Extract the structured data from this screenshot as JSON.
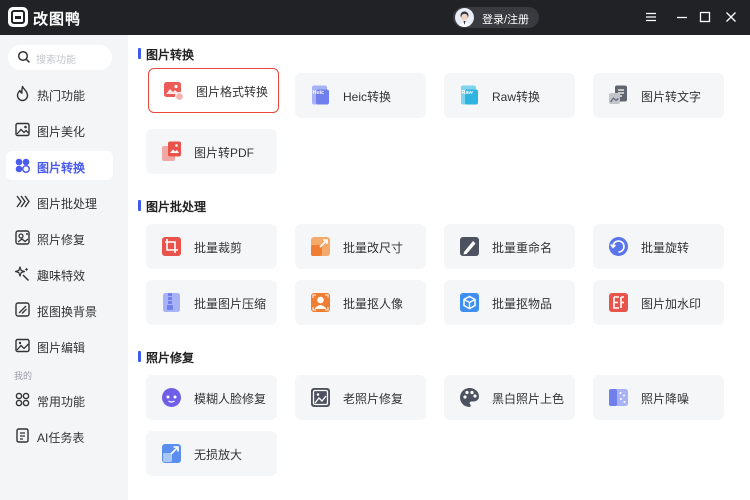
{
  "app": {
    "title": "改图鸭",
    "login_label": "登录/注册"
  },
  "colors": {
    "titlebar": "#212226",
    "accent": "#4a5cf0",
    "selected_border": "#e8483c",
    "sidebar_bg": "#f4f5f7",
    "card_bg": "#f5f6f8"
  },
  "sidebar": {
    "search_placeholder": "搜索功能",
    "items": [
      {
        "label": "热门功能",
        "icon": "fire-icon"
      },
      {
        "label": "图片美化",
        "icon": "image-beautify-icon"
      },
      {
        "label": "图片转换",
        "icon": "image-convert-icon",
        "active": true
      },
      {
        "label": "图片批处理",
        "icon": "batch-icon"
      },
      {
        "label": "照片修复",
        "icon": "photo-repair-icon"
      },
      {
        "label": "趣味特效",
        "icon": "sparkle-icon"
      },
      {
        "label": "抠图换背景",
        "icon": "cutout-icon"
      },
      {
        "label": "图片编辑",
        "icon": "image-edit-icon"
      }
    ],
    "group_label": "我的",
    "my_items": [
      {
        "label": "常用功能",
        "icon": "grid-icon"
      },
      {
        "label": "AI任务表",
        "icon": "task-list-icon"
      }
    ]
  },
  "sections": [
    {
      "title": "图片转换",
      "cards": [
        {
          "label": "图片格式转换",
          "icon": "image-format-icon",
          "selected": true
        },
        {
          "label": "Heic转换",
          "icon": "heic-icon"
        },
        {
          "label": "Raw转换",
          "icon": "raw-icon"
        },
        {
          "label": "图片转文字",
          "icon": "image-to-text-icon"
        },
        {
          "label": "图片转PDF",
          "icon": "image-to-pdf-icon"
        }
      ]
    },
    {
      "title": "图片批处理",
      "cards": [
        {
          "label": "批量裁剪",
          "icon": "batch-crop-icon"
        },
        {
          "label": "批量改尺寸",
          "icon": "batch-resize-icon"
        },
        {
          "label": "批量重命名",
          "icon": "batch-rename-icon"
        },
        {
          "label": "批量旋转",
          "icon": "batch-rotate-icon"
        },
        {
          "label": "批量图片压缩",
          "icon": "batch-compress-icon"
        },
        {
          "label": "批量抠人像",
          "icon": "batch-portrait-cutout-icon"
        },
        {
          "label": "批量抠物品",
          "icon": "batch-object-cutout-icon"
        },
        {
          "label": "图片加水印",
          "icon": "watermark-icon"
        }
      ]
    },
    {
      "title": "照片修复",
      "cards": [
        {
          "label": "模糊人脸修复",
          "icon": "face-repair-icon"
        },
        {
          "label": "老照片修复",
          "icon": "old-photo-icon"
        },
        {
          "label": "黑白照片上色",
          "icon": "colorize-icon"
        },
        {
          "label": "照片降噪",
          "icon": "denoise-icon"
        },
        {
          "label": "无损放大",
          "icon": "upscale-icon"
        }
      ]
    }
  ]
}
